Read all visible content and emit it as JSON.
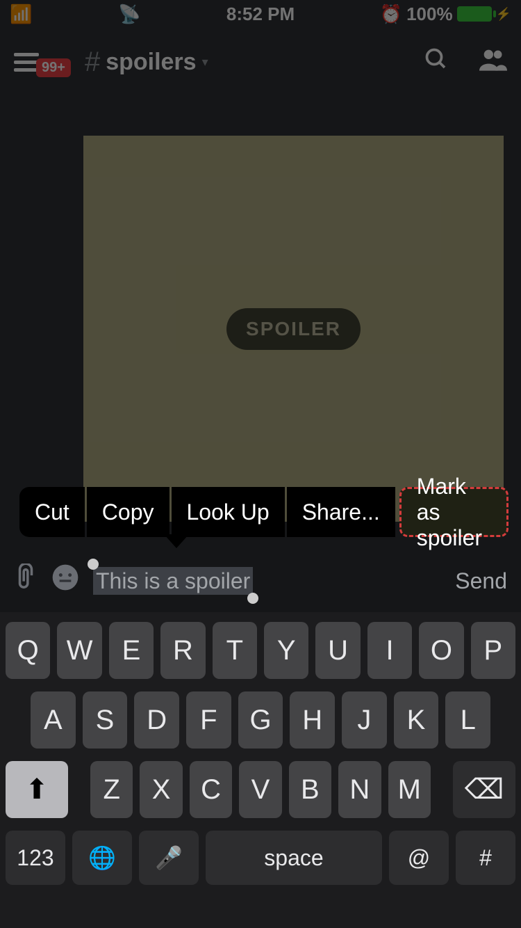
{
  "status": {
    "time": "8:52 PM",
    "battery_pct": "100%",
    "alarm_icon": "⏰"
  },
  "header": {
    "badge": "99+",
    "hash": "#",
    "channel": "spoilers",
    "chevron": "▾"
  },
  "attachment": {
    "spoiler_label": "SPOILER"
  },
  "context_menu": {
    "cut": "Cut",
    "copy": "Copy",
    "lookup": "Look Up",
    "share": "Share...",
    "mark_spoiler": "Mark as spoiler"
  },
  "compose": {
    "input_text": "This is a spoiler",
    "send": "Send"
  },
  "keyboard": {
    "row1": [
      "Q",
      "W",
      "E",
      "R",
      "T",
      "Y",
      "U",
      "I",
      "O",
      "P"
    ],
    "row2": [
      "A",
      "S",
      "D",
      "F",
      "G",
      "H",
      "J",
      "K",
      "L"
    ],
    "row3": [
      "Z",
      "X",
      "C",
      "V",
      "B",
      "N",
      "M"
    ],
    "shift": "⬆",
    "backspace": "⌫",
    "numbers": "123",
    "globe": "🌐",
    "mic": "🎤",
    "space": "space",
    "at": "@",
    "hash": "#"
  }
}
